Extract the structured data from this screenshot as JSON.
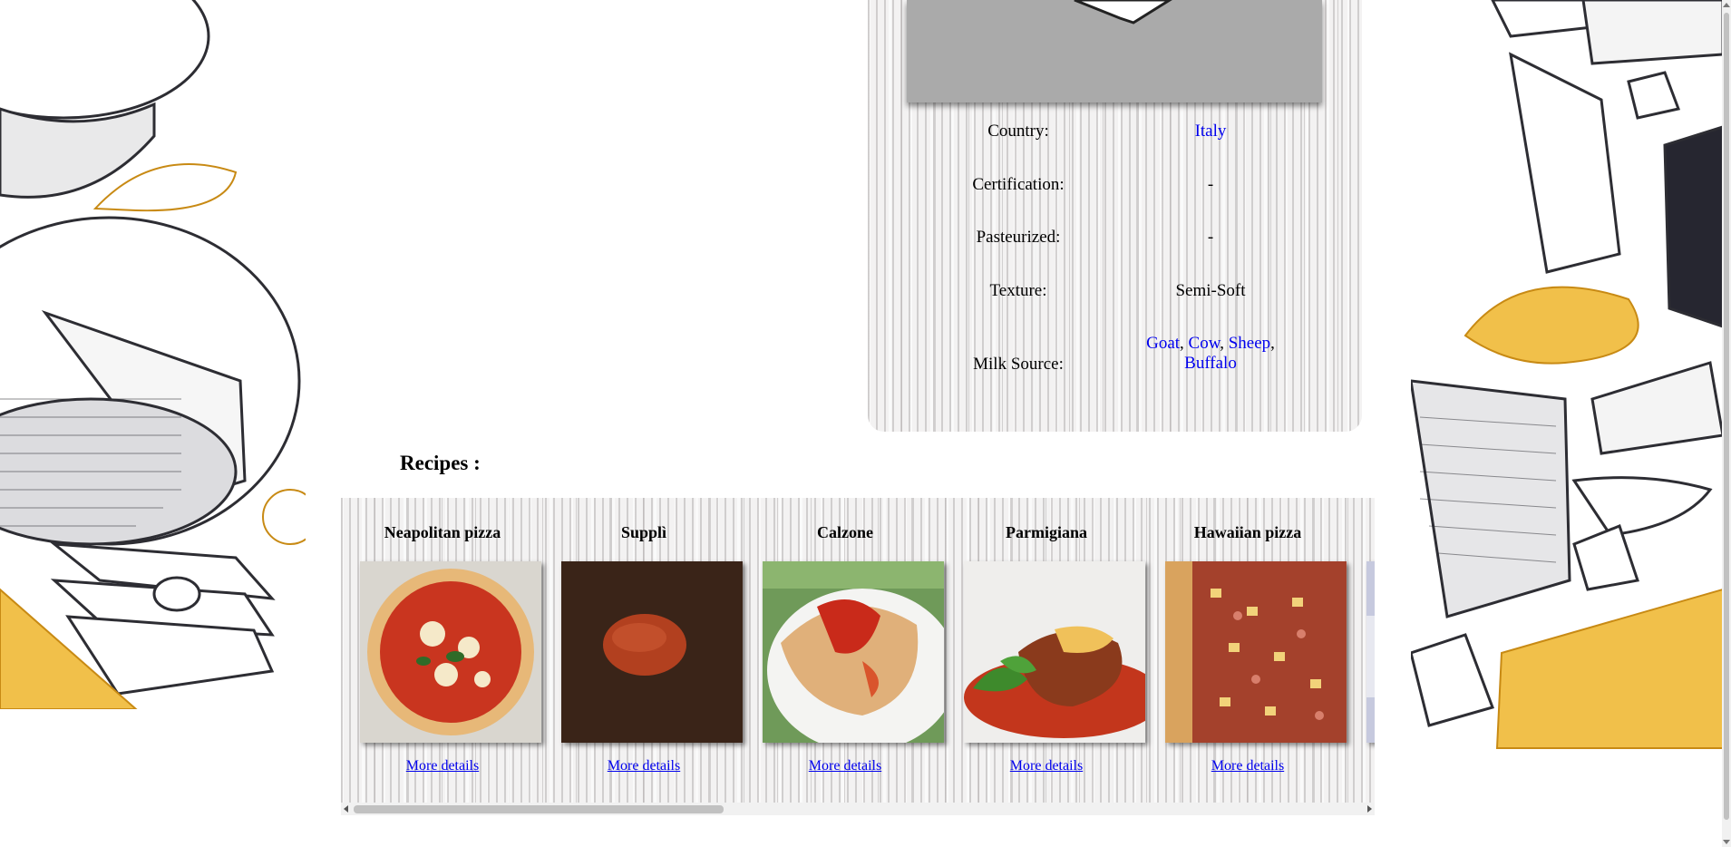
{
  "cheese": {
    "rows": [
      {
        "label": "Country:",
        "value": "Italy",
        "link": true
      },
      {
        "label": "Certification:",
        "value": "-",
        "link": false
      },
      {
        "label": "Pasteurized:",
        "value": "-",
        "link": false
      },
      {
        "label": "Texture:",
        "value": "Semi-Soft",
        "link": false
      }
    ],
    "milk_source": {
      "label": "Milk Source:",
      "values": [
        "Goat",
        "Cow",
        "Sheep",
        "Buffalo"
      ],
      "separator": ","
    }
  },
  "recipes": {
    "title": "Recipes :",
    "link_label": "More details",
    "items": [
      {
        "name": "Neapolitan pizza",
        "photo": "neapolitan-pizza"
      },
      {
        "name": "Supplì",
        "photo": "suppli"
      },
      {
        "name": "Calzone",
        "photo": "calzone"
      },
      {
        "name": "Parmigiana",
        "photo": "parmigiana"
      },
      {
        "name": "Hawaiian pizza",
        "photo": "hawaiian-pizza"
      },
      {
        "name": "",
        "photo": "next-recipe"
      }
    ]
  },
  "colors": {
    "link": "#0000ee",
    "image_placeholder": "#aaaaaa",
    "mustard_accent": "#e0a224",
    "ink": "#2d2d33"
  }
}
